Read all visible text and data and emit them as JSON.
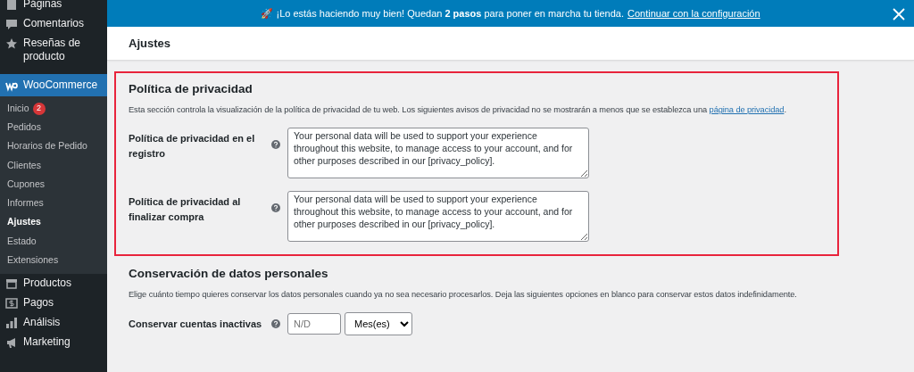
{
  "sidebar": {
    "items": [
      {
        "label": "Páginas",
        "selected": false
      },
      {
        "label": "Comentarios",
        "selected": false
      },
      {
        "label": "Reseñas de producto",
        "selected": false
      },
      {
        "label": "WooCommerce",
        "selected": true,
        "children": [
          {
            "label": "Inicio",
            "badge": "2",
            "selected": false
          },
          {
            "label": "Pedidos",
            "selected": false
          },
          {
            "label": "Horarios de Pedido",
            "selected": false
          },
          {
            "label": "Clientes",
            "selected": false
          },
          {
            "label": "Cupones",
            "selected": false
          },
          {
            "label": "Informes",
            "selected": false
          },
          {
            "label": "Ajustes",
            "selected": true
          },
          {
            "label": "Estado",
            "selected": false
          },
          {
            "label": "Extensiones",
            "selected": false
          }
        ]
      },
      {
        "label": "Productos",
        "selected": false
      },
      {
        "label": "Pagos",
        "selected": false
      },
      {
        "label": "Análisis",
        "selected": false
      },
      {
        "label": "Marketing",
        "selected": false
      }
    ]
  },
  "notice": {
    "text": "🚀 ¡Lo estás haciendo muy bien! Quedan **2 pasos** para poner en marcha tu tienda.",
    "link": "Continuar con la configuración"
  },
  "page_title": "Ajustes",
  "sections": [
    {
      "title": "Política de privacidad",
      "highlighted": true,
      "description": "Esta sección controla la visualización de la política de privacidad de tu web. Los siguientes avisos de privacidad no se mostrarán a menos que se establezca una",
      "link": "página de privacidad",
      "suffix": ".",
      "fields": [
        {
          "kind": "textarea",
          "label": "Política de privacidad en el registro",
          "value": "Your personal data will be used to support your experience throughout this website, to manage access to your account, and for other purposes described in our [privacy_policy]."
        },
        {
          "kind": "textarea",
          "label": "Política de privacidad al finalizar compra",
          "value": "Your personal data will be used to support your experience throughout this website, to manage access to your account, and for other purposes described in our [privacy_policy]."
        }
      ]
    },
    {
      "title": "Conservación de datos personales",
      "highlighted": false,
      "description": "Elige cuánto tiempo quieres conservar los datos personales cuando ya no sea necesario procesarlos. Deja las siguientes opciones en blanco para conservar estos datos indefinidamente.",
      "fields": [
        {
          "kind": "duration",
          "label": "Conservar cuentas inactivas",
          "placeholder": "N/D",
          "unit": "Mes(es)"
        }
      ]
    }
  ]
}
